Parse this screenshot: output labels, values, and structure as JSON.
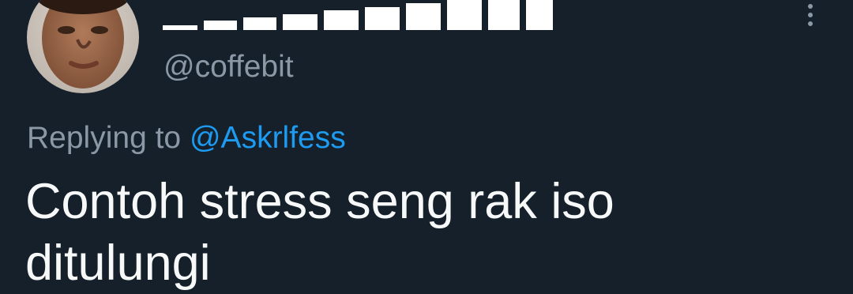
{
  "tweet": {
    "display_name_redacted": true,
    "handle": "@coffebit",
    "reply_prefix": "Replying to",
    "reply_to": "@Askrlfess",
    "text": "Contoh stress seng rak iso\nditulungi",
    "avatar_icon": "user-avatar-photo",
    "menu_icon": "more-vertical-icon"
  },
  "colors": {
    "background": "#15202b",
    "primary_text": "#f7f9f9",
    "secondary_text": "#8b98a5",
    "accent": "#1d9bf0"
  }
}
